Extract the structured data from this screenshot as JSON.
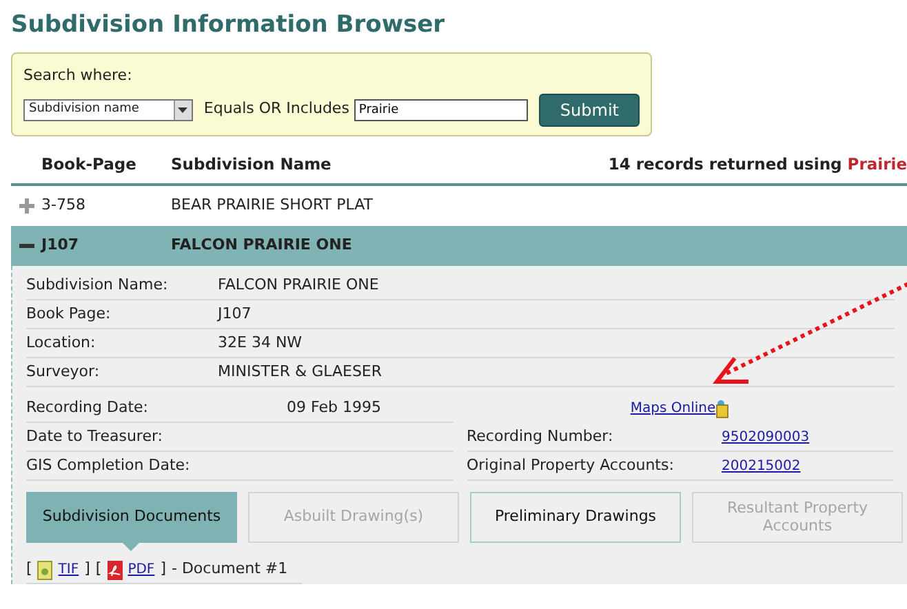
{
  "title": "Subdivision Information Browser",
  "search": {
    "label": "Search where:",
    "field": "Subdivision name",
    "operator": "Equals OR Includes",
    "value": "Prairie",
    "button": "Submit"
  },
  "table": {
    "columns": [
      "Book-Page",
      "Subdivision Name"
    ],
    "summary": "14 records returned using ",
    "summary_term": "Prairie",
    "rows": [
      {
        "book_page": "3-758",
        "name": "BEAR PRAIRIE SHORT PLAT",
        "expanded": false
      },
      {
        "book_page": "J107",
        "name": "FALCON PRAIRIE ONE",
        "expanded": true
      }
    ]
  },
  "details": [
    {
      "label": "Subdivision Name:",
      "value": "FALCON PRAIRIE ONE"
    },
    {
      "label": "Book Page:",
      "value": "J107"
    },
    {
      "label": "Location:",
      "value": "32E 34 NW"
    },
    {
      "label": "Surveyor:",
      "value": "MINISTER & GLAESER"
    }
  ],
  "detail_grid": [
    {
      "left": {
        "label": "Recording Date:",
        "value": "09 Feb 1995"
      },
      "right": {
        "link": "Maps Online"
      }
    },
    {
      "left": {
        "label": "Date to Treasurer:"
      },
      "right": {
        "label": "Recording Number:",
        "link": "9502090003"
      }
    },
    {
      "left": {
        "label": "GIS Completion Date:"
      },
      "right": {
        "label": "Original Property Accounts:",
        "link": "200215002"
      }
    }
  ],
  "tabs": [
    {
      "label": "Subdivision Documents",
      "selected": true,
      "disabled": false
    },
    {
      "label": "Asbuilt Drawing(s)",
      "selected": false,
      "disabled": true
    },
    {
      "label": "Preliminary Drawings",
      "selected": false,
      "disabled": false
    },
    {
      "label": "Resultant Property Accounts",
      "selected": false,
      "disabled": true
    }
  ],
  "documents": [
    {
      "links": [
        {
          "kind": "tif",
          "open": "[",
          "label": "TIF",
          "close": "]"
        },
        {
          "kind": "pdf",
          "open": "[",
          "label": "PDF",
          "close": "]"
        }
      ],
      "title": "- Document #1"
    }
  ]
}
